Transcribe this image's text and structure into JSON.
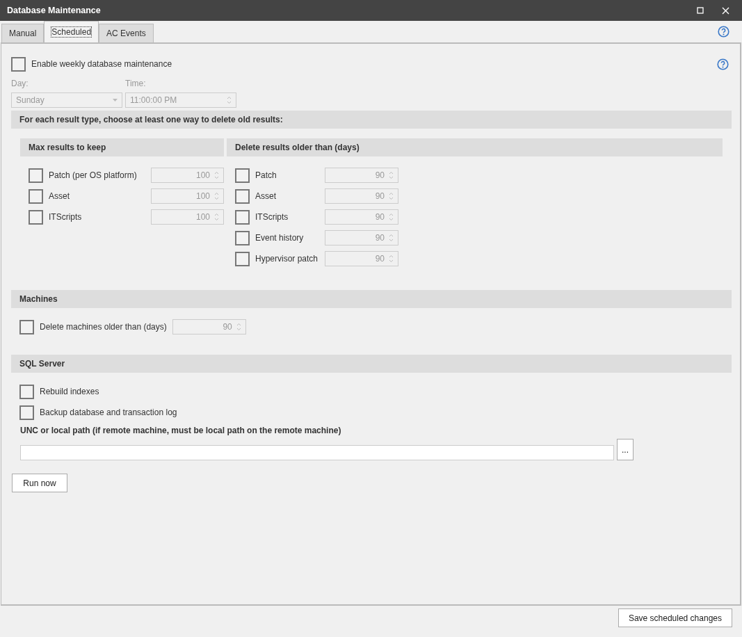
{
  "window": {
    "title": "Database Maintenance"
  },
  "tabs": [
    {
      "label": "Manual",
      "selected": false
    },
    {
      "label": "Scheduled",
      "selected": true
    },
    {
      "label": "AC Events",
      "selected": false
    }
  ],
  "enable": {
    "label": "Enable weekly database maintenance",
    "checked": false
  },
  "day": {
    "label": "Day:",
    "value": "Sunday",
    "disabled": true
  },
  "time": {
    "label": "Time:",
    "value": "11:00:00 PM",
    "disabled": true
  },
  "results_heading": "For each result type, choose at least one way to delete old results:",
  "max_results": {
    "heading": "Max results to keep",
    "items": [
      {
        "label": "Patch (per OS platform)",
        "checked": false,
        "value": "100",
        "disabled": true
      },
      {
        "label": "Asset",
        "checked": false,
        "value": "100",
        "disabled": true
      },
      {
        "label": "ITScripts",
        "checked": false,
        "value": "100",
        "disabled": true
      }
    ]
  },
  "delete_older": {
    "heading": "Delete results older than (days)",
    "items": [
      {
        "label": "Patch",
        "checked": false,
        "value": "90",
        "disabled": true
      },
      {
        "label": "Asset",
        "checked": false,
        "value": "90",
        "disabled": true
      },
      {
        "label": "ITScripts",
        "checked": false,
        "value": "90",
        "disabled": true
      },
      {
        "label": "Event history",
        "checked": false,
        "value": "90",
        "disabled": true
      },
      {
        "label": "Hypervisor patch",
        "checked": false,
        "value": "90",
        "disabled": true
      }
    ]
  },
  "machines": {
    "heading": "Machines",
    "item": {
      "label": "Delete machines older than (days)",
      "checked": false,
      "value": "90",
      "disabled": true
    }
  },
  "sql": {
    "heading": "SQL Server",
    "options": [
      {
        "label": "Rebuild indexes",
        "checked": false
      },
      {
        "label": "Backup database and transaction log",
        "checked": false
      }
    ],
    "path_label": "UNC or local path (if remote machine, must be local path on the remote machine)",
    "browse": "..."
  },
  "run_now": "Run now",
  "save": "Save scheduled changes"
}
